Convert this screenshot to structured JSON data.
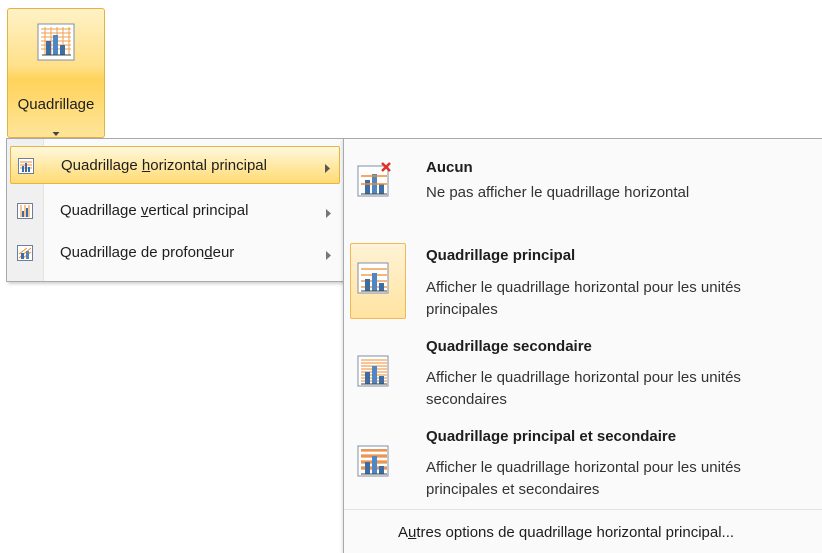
{
  "ribbon": {
    "button_icon": "chart-gridlines-icon",
    "button_label": "Quadrillage"
  },
  "menu": {
    "items": [
      {
        "pre": "Quadrillage ",
        "mnemonic": "h",
        "post": "orizontal principal",
        "icon": "horizontal-gridlines-icon",
        "highlighted": true
      },
      {
        "pre": "Quadrillage ",
        "mnemonic": "v",
        "post": "ertical principal",
        "icon": "vertical-gridlines-icon",
        "highlighted": false
      },
      {
        "pre": "Quadrillage de profon",
        "mnemonic": "d",
        "post": "eur",
        "icon": "depth-gridlines-icon",
        "highlighted": false
      }
    ]
  },
  "submenu": {
    "options": [
      {
        "title": "Aucun",
        "desc": "Ne pas afficher le quadrillage horizontal",
        "icon": "no-gridlines-icon",
        "selected": false
      },
      {
        "title": "Quadrillage principal",
        "desc": "Afficher le quadrillage horizontal pour les unités principales",
        "icon": "major-gridlines-icon",
        "selected": true
      },
      {
        "title": "Quadrillage secondaire",
        "desc": "Afficher le quadrillage horizontal pour les unités secondaires",
        "icon": "minor-gridlines-icon",
        "selected": false
      },
      {
        "title": "Quadrillage principal et secondaire",
        "desc": "Afficher le quadrillage horizontal pour les unités principales et secondaires",
        "icon": "major-minor-gridlines-icon",
        "selected": false
      }
    ],
    "more": {
      "pre": "A",
      "mnemonic": "u",
      "post": "tres options de quadrillage horizontal principal..."
    }
  },
  "colors": {
    "highlight": "#ffe08a",
    "highlight_border": "#e3b244",
    "gridline_orange": "#f08c2c",
    "bar_blue": "#3a6ea5",
    "delete_red": "#e0302a"
  }
}
